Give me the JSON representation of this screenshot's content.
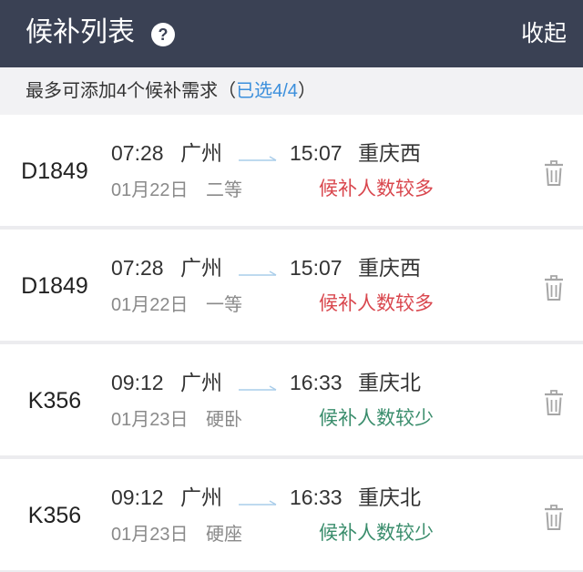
{
  "header": {
    "title": "候补列表",
    "help_icon": "question-circle-icon",
    "help_glyph": "?",
    "collapse_label": "收起"
  },
  "notice": {
    "prefix": "最多可添加4个候补需求（",
    "selected": "已选4/4",
    "suffix": "）"
  },
  "icons": {
    "route_arrow": "arrow-right-icon",
    "delete": "trash-icon"
  },
  "colors": {
    "header_bg": "#3a4154",
    "notice_bg": "#f2f2f4",
    "selected_link": "#3b8fdc",
    "route_arrow": "#a9cdea",
    "trash_icon": "#a6a6a6"
  },
  "candidates": [
    {
      "train": "D1849",
      "depart_time": "07:28",
      "depart_station": "广州",
      "arrive_time": "15:07",
      "arrive_station": "重庆西",
      "date": "01月22日",
      "seat_class": "二等",
      "status": "候补人数较多",
      "status_color": "#d9474e"
    },
    {
      "train": "D1849",
      "depart_time": "07:28",
      "depart_station": "广州",
      "arrive_time": "15:07",
      "arrive_station": "重庆西",
      "date": "01月22日",
      "seat_class": "一等",
      "status": "候补人数较多",
      "status_color": "#d9474e"
    },
    {
      "train": "K356",
      "depart_time": "09:12",
      "depart_station": "广州",
      "arrive_time": "16:33",
      "arrive_station": "重庆北",
      "date": "01月23日",
      "seat_class": "硬卧",
      "status": "候补人数较少",
      "status_color": "#3a8d6c"
    },
    {
      "train": "K356",
      "depart_time": "09:12",
      "depart_station": "广州",
      "arrive_time": "16:33",
      "arrive_station": "重庆北",
      "date": "01月23日",
      "seat_class": "硬座",
      "status": "候补人数较少",
      "status_color": "#3a8d6c"
    }
  ]
}
